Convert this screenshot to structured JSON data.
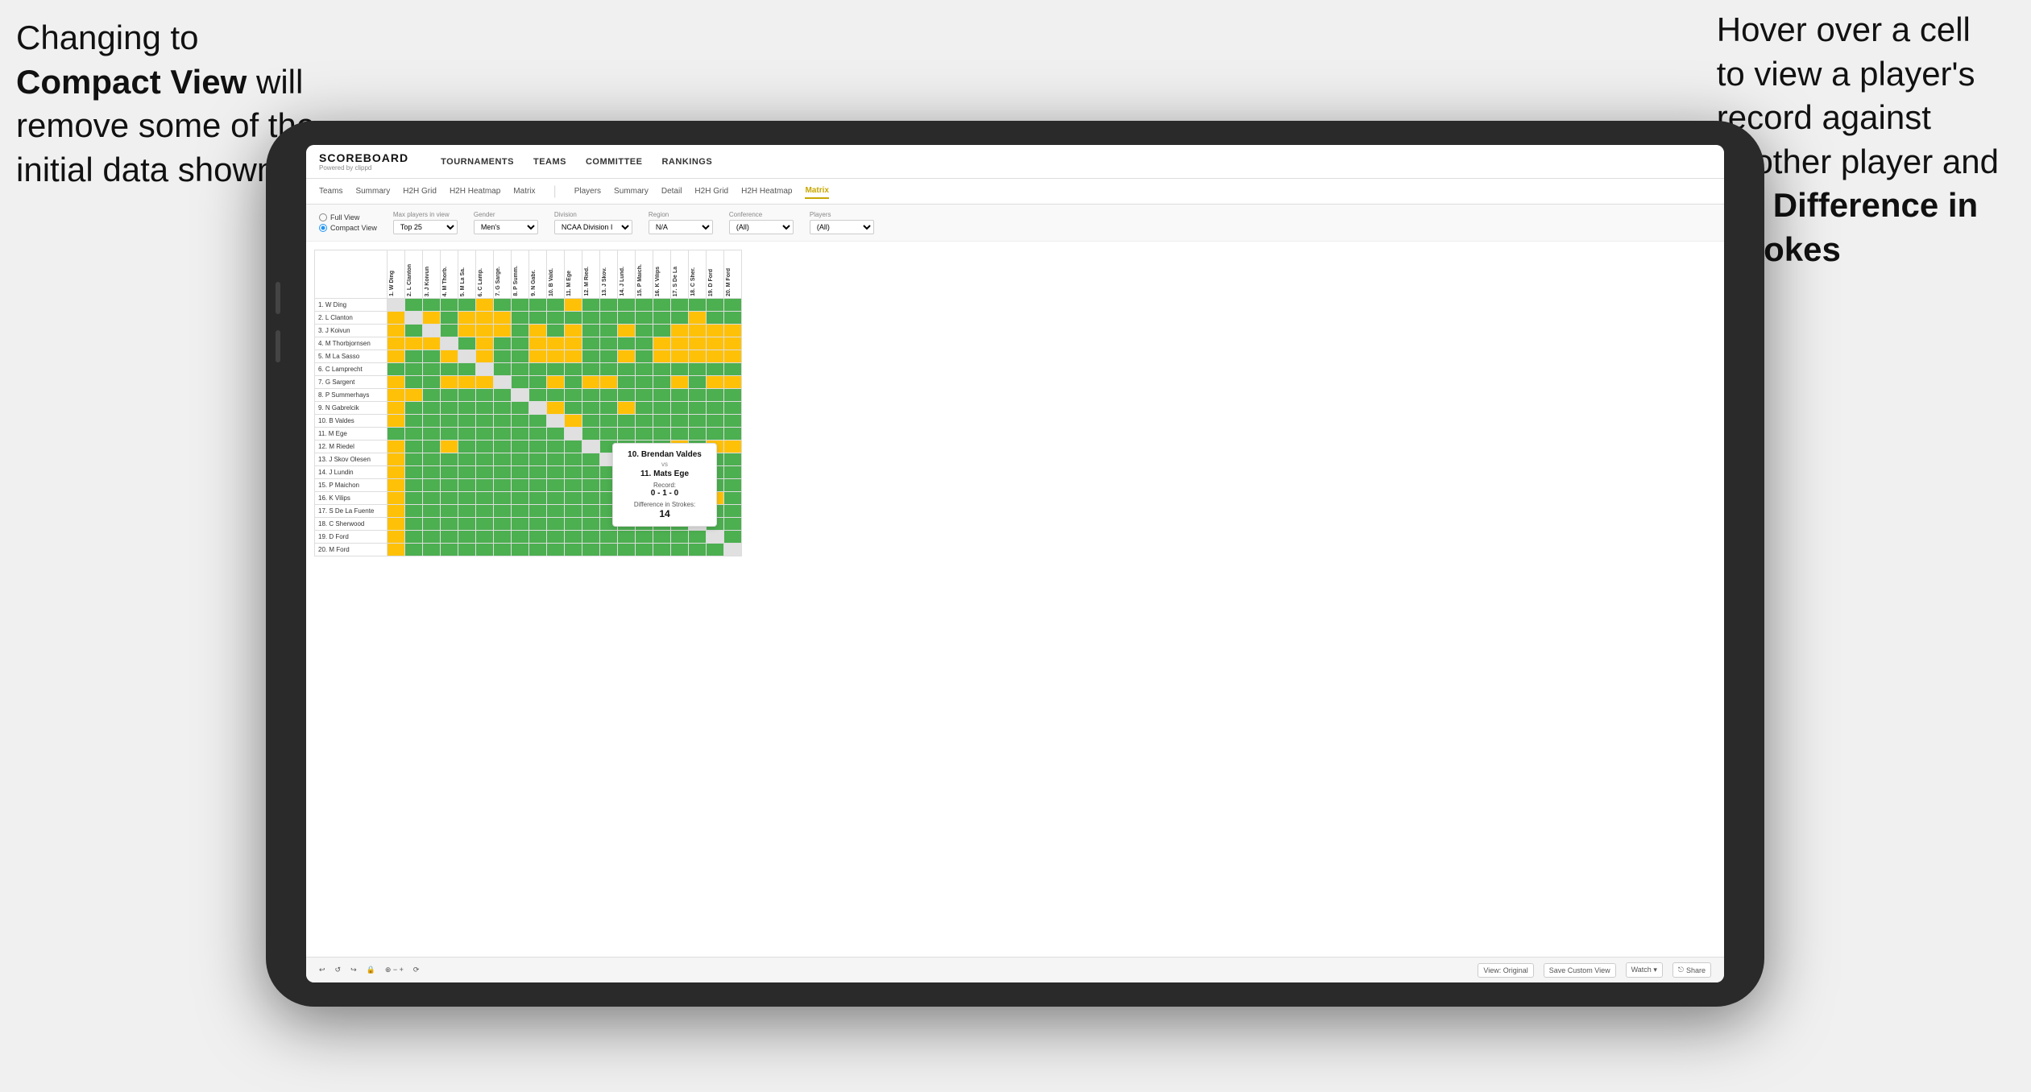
{
  "annotations": {
    "left_title": "Changing to",
    "left_bold": "Compact View",
    "left_text": " will\nremove some of the\ninitial data shown",
    "right_text": "Hover over a cell\nto view a player's\nrecord against\nanother player and\nthe ",
    "right_bold": "Difference in\nStrokes"
  },
  "nav": {
    "logo": "SCOREBOARD",
    "logo_sub": "Powered by clippd",
    "items": [
      "TOURNAMENTS",
      "TEAMS",
      "COMMITTEE",
      "RANKINGS"
    ]
  },
  "sub_tabs": {
    "group1": [
      "Teams",
      "Summary",
      "H2H Grid",
      "H2H Heatmap",
      "Matrix"
    ],
    "group2": [
      "Players",
      "Summary",
      "Detail",
      "H2H Grid",
      "H2H Heatmap",
      "Matrix"
    ],
    "active": "Matrix"
  },
  "filters": {
    "view_options": [
      "Full View",
      "Compact View"
    ],
    "selected_view": "Compact View",
    "max_players_label": "Max players in view",
    "max_players_value": "Top 25",
    "gender_label": "Gender",
    "gender_value": "Men's",
    "division_label": "Division",
    "division_value": "NCAA Division I",
    "region_label": "Region",
    "region_value": "N/A",
    "conference_label": "Conference",
    "conference_value": "(All)",
    "players_label": "Players",
    "players_value": "(All)"
  },
  "players": [
    "1. W Ding",
    "2. L Clanton",
    "3. J Koivun",
    "4. M Thorbjornsen",
    "5. M La Sasso",
    "6. C Lamprecht",
    "7. G Sargent",
    "8. P Summerhays",
    "9. N Gabrelcik",
    "10. B Valdes",
    "11. M Ege",
    "12. M Riedel",
    "13. J Skov Olesen",
    "14. J Lundin",
    "15. P Maichon",
    "16. K Vilips",
    "17. S De La Fuente",
    "18. C Sherwood",
    "19. D Ford",
    "20. M Ford"
  ],
  "col_headers": [
    "1. W Ding",
    "2. L Clanton",
    "3. J Koivun",
    "4. M Thorb...",
    "5. M La Sa...",
    "6. C Lamp...",
    "7. G Sarge...",
    "8. P Summ...",
    "9. N Gabr...",
    "10. B Vald...",
    "11. M Ege",
    "12. M Ried...",
    "13. J Skov...",
    "14. J Lund...",
    "15. P Maich...",
    "16. K Vilips",
    "17. S De La...",
    "18. C Sher...",
    "19. D Ford",
    "20. M Ford"
  ],
  "tooltip": {
    "player1": "10. Brendan Valdes",
    "vs": "vs",
    "player2": "11. Mats Ege",
    "record_label": "Record:",
    "record": "0 - 1 - 0",
    "diff_label": "Difference in Strokes:",
    "diff": "14"
  },
  "toolbar": {
    "undo": "↩",
    "redo": "↪",
    "view_original": "View: Original",
    "save_custom": "Save Custom View",
    "watch": "Watch ▾",
    "share": "Share"
  }
}
